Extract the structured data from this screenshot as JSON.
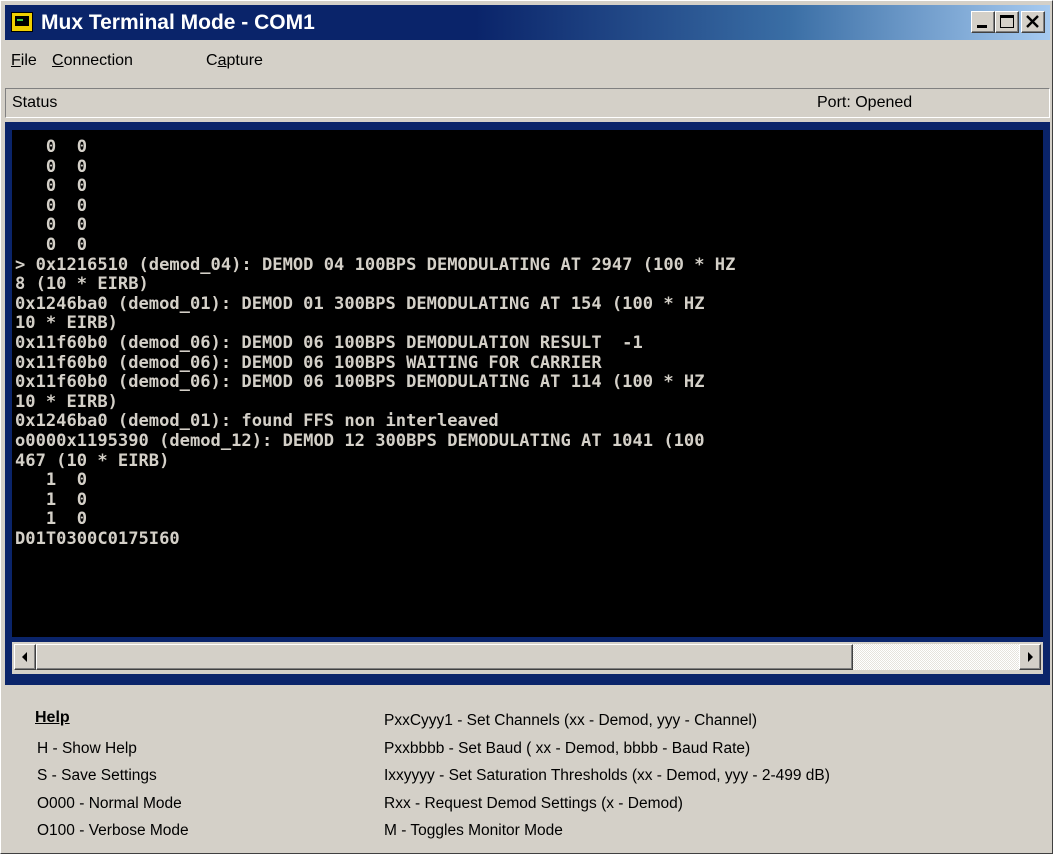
{
  "window": {
    "title": "Mux Terminal Mode - COM1"
  },
  "menu": [
    {
      "label": "File",
      "accel": "F",
      "rest": "ile"
    },
    {
      "label": "Connection",
      "accel": "C",
      "rest": "onnection"
    },
    {
      "label": "Capture",
      "pre": "C",
      "accel": "a",
      "rest": "pture"
    }
  ],
  "status": {
    "label": "Status",
    "port_text": "Port:  Opened"
  },
  "terminal": {
    "lines": [
      "   0  0",
      "   0  0",
      "   0  0",
      "   0  0",
      "   0  0",
      "   0  0",
      "> 0x1216510 (demod_04): DEMOD 04 100BPS DEMODULATING AT 2947 (100 * HZ",
      "8 (10 * EIRB)",
      "0x1246ba0 (demod_01): DEMOD 01 300BPS DEMODULATING AT 154 (100 * HZ",
      "10 * EIRB)",
      "0x11f60b0 (demod_06): DEMOD 06 100BPS DEMODULATION RESULT  -1",
      "0x11f60b0 (demod_06): DEMOD 06 100BPS WAITING FOR CARRIER",
      "0x11f60b0 (demod_06): DEMOD 06 100BPS DEMODULATING AT 114 (100 * HZ",
      "10 * EIRB)",
      "0x1246ba0 (demod_01): found FFS non interleaved",
      "o0000x1195390 (demod_12): DEMOD 12 300BPS DEMODULATING AT 1041 (100",
      "467 (10 * EIRB)",
      "   1  0",
      "   1  0",
      "   1  0",
      "D01T0300C0175I60"
    ]
  },
  "help": {
    "title": "Help",
    "left": [
      "H - Show Help",
      "S - Save Settings",
      "O000 - Normal Mode",
      "O100 - Verbose Mode"
    ],
    "right": [
      "PxxCyyy1 - Set Channels (xx - Demod, yyy - Channel)",
      "Pxxbbbb - Set Baud ( xx - Demod, bbbb - Baud Rate)",
      "Ixxyyyy - Set Saturation Thresholds (xx - Demod, yyy - 2-499 dB)",
      "Rxx - Request Demod Settings (x - Demod)",
      "M - Toggles Monitor Mode"
    ]
  },
  "colors": {
    "title_active": "#0a246a",
    "terminal_bg": "#000000",
    "terminal_fg": "#d4d0c8",
    "face": "#d4d0c8"
  }
}
